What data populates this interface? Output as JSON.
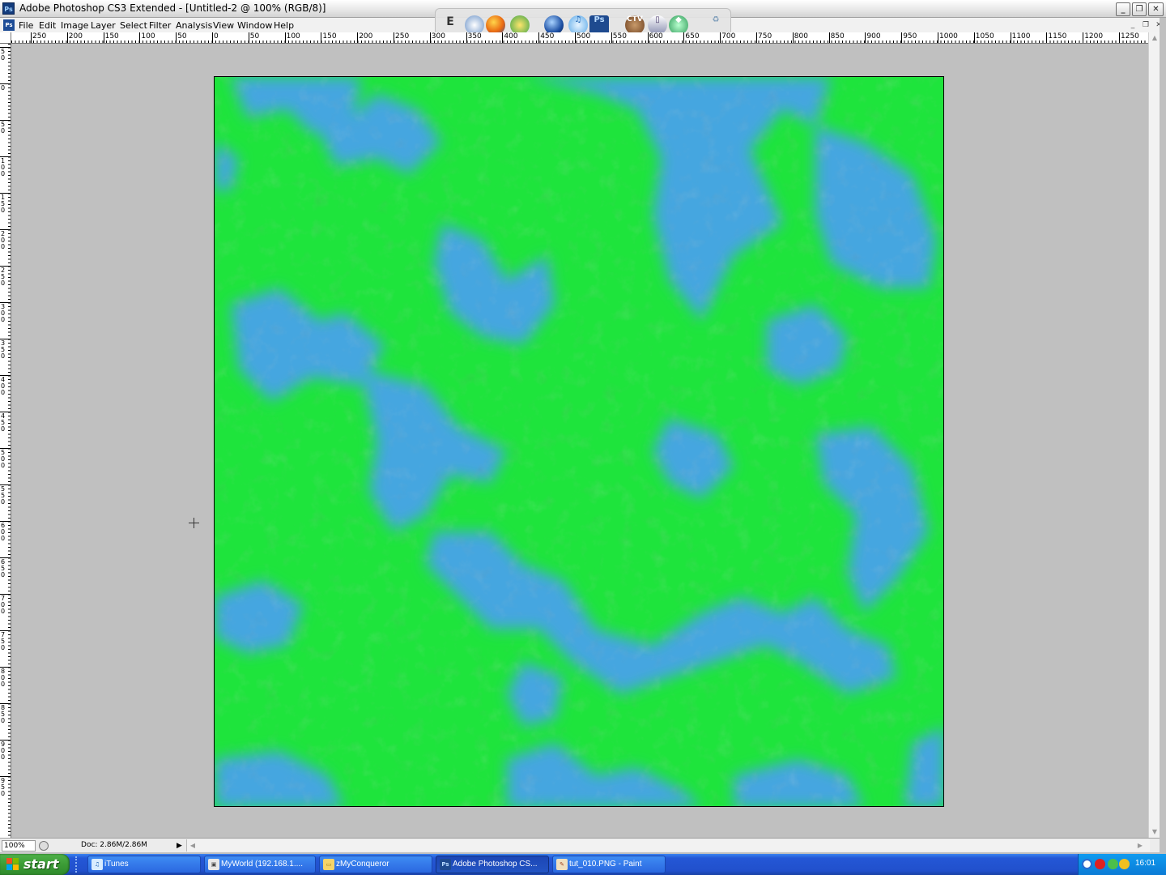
{
  "window": {
    "title": "Adobe Photoshop CS3 Extended - [Untitled-2 @ 100% (RGB/8)]",
    "app_icon": "Ps",
    "buttons": {
      "minimize": "_",
      "restore": "❐",
      "close": "✕"
    }
  },
  "dock": {
    "icons": [
      "text-editor-icon",
      "network-icon",
      "firefox-icon",
      "globe-icon",
      "google-earth-icon",
      "itunes-icon",
      "photoshop-icon",
      "ctv-icon",
      "mail-icon",
      "sims-icon",
      "recycle-bin-icon"
    ],
    "ps_label": "Ps",
    "ctv_label": "CTV"
  },
  "menu": {
    "doc_icon": "Ps",
    "items": [
      "File",
      "Edit",
      "Image",
      "Layer",
      "Select",
      "Filter",
      "Analysis",
      "View",
      "Window",
      "Help"
    ]
  },
  "rulers": {
    "top_labels": [
      "250",
      "200",
      "150",
      "100",
      "50",
      "0",
      "50",
      "100",
      "150",
      "200",
      "250",
      "300",
      "350",
      "400",
      "450",
      "500",
      "550",
      "600",
      "650",
      "700",
      "750",
      "800",
      "850",
      "900",
      "950",
      "1000",
      "1050",
      "1100",
      "1150",
      "1200",
      "1250"
    ],
    "left_labels": [
      "50",
      "0",
      "50",
      "100",
      "150",
      "200",
      "250",
      "300",
      "350",
      "400",
      "450",
      "500",
      "550",
      "600",
      "650",
      "700",
      "750",
      "800",
      "850",
      "900",
      "950"
    ]
  },
  "canvas": {
    "colors": {
      "land": "#1ee43c",
      "water": "#45a6e0"
    }
  },
  "status": {
    "zoom": "100%",
    "doc_size": "Doc: 2.86M/2.86M",
    "arrow": "▶"
  },
  "taskbar": {
    "start_label": "start",
    "tasks": [
      {
        "label": "iTunes",
        "icon": "itunes-icon"
      },
      {
        "label": "MyWorld (192.168.1....",
        "icon": "remote-desktop-icon"
      },
      {
        "label": "zMyConqueror",
        "icon": "folder-icon"
      },
      {
        "label": "Adobe Photoshop CS...",
        "icon": "photoshop-icon"
      },
      {
        "label": "tut_010.PNG - Paint",
        "icon": "paint-icon"
      }
    ],
    "clock": "16:01"
  }
}
